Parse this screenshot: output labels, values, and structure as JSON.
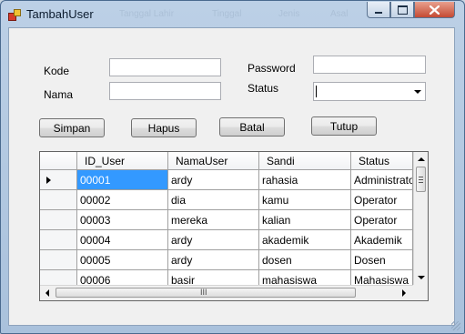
{
  "window": {
    "title": "TambahUser"
  },
  "ghost_headers": [
    "Tanggal Lahir",
    "Tinggal",
    "Jenis",
    "Asal"
  ],
  "form": {
    "kode_label": "Kode",
    "kode_value": "",
    "nama_label": "Nama",
    "nama_value": "",
    "password_label": "Password",
    "password_value": "",
    "status_label": "Status",
    "status_value": ""
  },
  "buttons": {
    "simpan": "Simpan",
    "hapus": "Hapus",
    "batal": "Batal",
    "tutup": "Tutup"
  },
  "grid": {
    "columns": [
      "ID_User",
      "NamaUser",
      "Sandi",
      "Status"
    ],
    "rows": [
      [
        "00001",
        "ardy",
        "rahasia",
        "Administrator"
      ],
      [
        "00002",
        "dia",
        "kamu",
        "Operator"
      ],
      [
        "00003",
        "mereka",
        "kalian",
        "Operator"
      ],
      [
        "00004",
        "ardy",
        "akademik",
        "Akademik"
      ],
      [
        "00005",
        "ardy",
        "dosen",
        "Dosen"
      ],
      [
        "00006",
        "basir",
        "mahasiswa",
        "Mahasiswa"
      ]
    ],
    "selected_row": 0,
    "hscroll_grip": "III"
  },
  "colors": {
    "selection": "#3399ff",
    "close_button": "#c54a33",
    "frame": "#bcd0e6"
  },
  "icons": [
    "app-icon",
    "minimize-icon",
    "maximize-icon",
    "close-icon",
    "row-pointer-icon",
    "scroll-up-icon",
    "scroll-down-icon",
    "scroll-left-icon",
    "scroll-right-icon",
    "size-grip-icon"
  ]
}
